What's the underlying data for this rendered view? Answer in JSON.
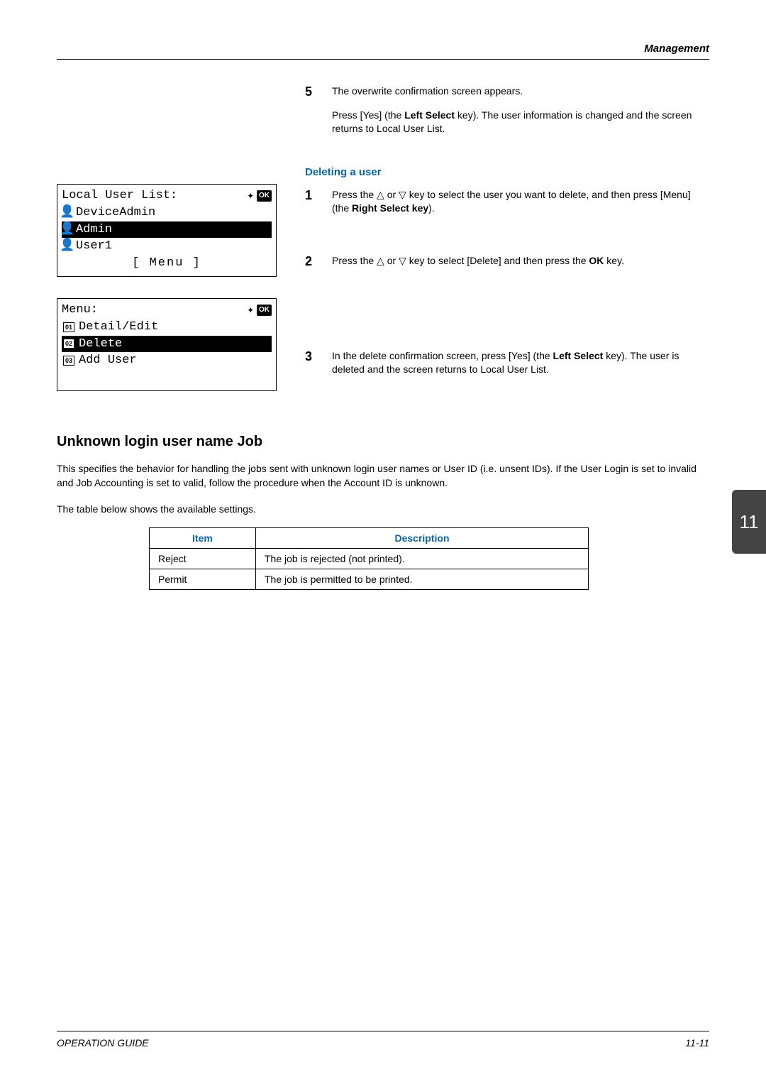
{
  "header": {
    "section": "Management"
  },
  "steps_top": {
    "s5": {
      "num": "5",
      "l1": "The overwrite confirmation screen appears.",
      "l2a": "Press [Yes] (the ",
      "l2b": "Left Select",
      "l2c": " key). The user information is changed and the screen returns to Local User List."
    }
  },
  "subheading": "Deleting a user",
  "del_steps": {
    "s1": {
      "num": "1",
      "a": "Press the ",
      "b": " or ",
      "c": " key to select the user you want to delete, and then press [Menu] (the ",
      "d": "Right Select key",
      "e": ")."
    },
    "s2": {
      "num": "2",
      "a": "Press the ",
      "b": " or ",
      "c": " key to select [Delete] and then press the ",
      "d": "OK",
      "e": " key."
    },
    "s3": {
      "num": "3",
      "a": "In the delete confirmation screen, press [Yes] (the ",
      "b": "Left Select",
      "c": " key). The user is deleted and the screen returns to Local User List."
    }
  },
  "lcd1": {
    "title": "Local User List:",
    "ok": "OK",
    "rows": [
      "DeviceAdmin",
      "Admin",
      "User1"
    ],
    "menu_label": "[  Menu   ]"
  },
  "lcd2": {
    "title": "Menu:",
    "ok": "OK",
    "opts": [
      {
        "n": "01",
        "t": "Detail/Edit"
      },
      {
        "n": "02",
        "t": "Delete"
      },
      {
        "n": "03",
        "t": "Add User"
      }
    ]
  },
  "section": {
    "h1": "Unknown login user name Job",
    "p1": "This specifies the behavior for handling the jobs sent with unknown login user names or User ID (i.e. unsent IDs). If the User Login is set to invalid and Job Accounting is set to valid, follow the procedure when the Account ID is unknown.",
    "p2": "The table below shows the available settings."
  },
  "table": {
    "h_item": "Item",
    "h_desc": "Description",
    "rows": [
      {
        "item": "Reject",
        "desc": "The job is rejected (not printed)."
      },
      {
        "item": "Permit",
        "desc": "The job is permitted to be printed."
      }
    ]
  },
  "tab": "11",
  "footer": {
    "left": "OPERATION GUIDE",
    "right": "11-11"
  },
  "tri_up": "△",
  "tri_dn": "▽",
  "diamond": "✦",
  "user_glyph": "👤"
}
